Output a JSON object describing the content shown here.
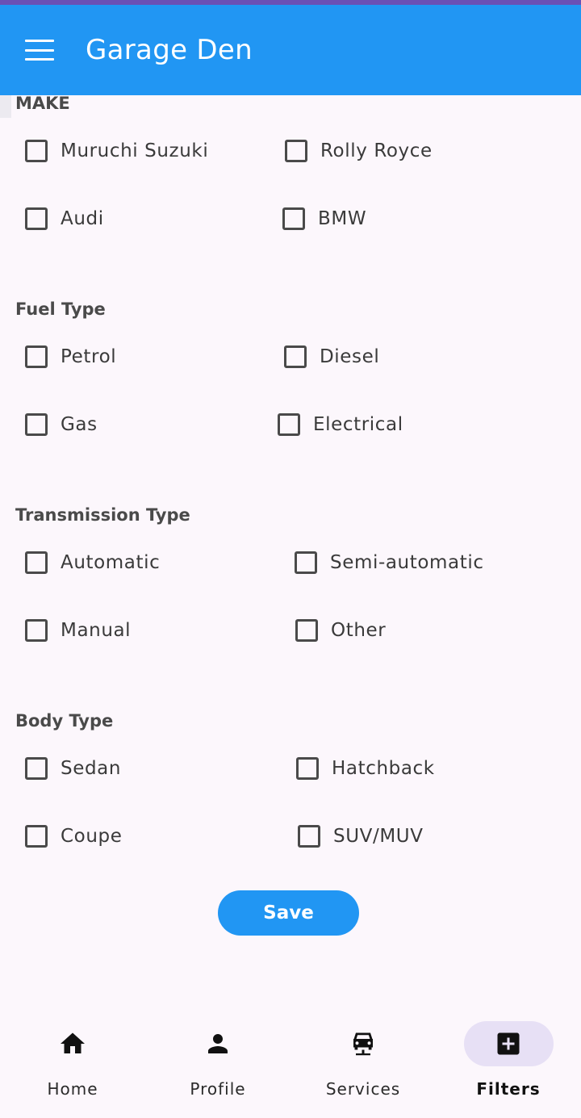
{
  "app_bar": {
    "title": "Garage Den",
    "background": "#2196f3"
  },
  "sections": {
    "make": {
      "title": "MAKE",
      "options": [
        "Muruchi Suzuki",
        "Rolly Royce",
        "Audi",
        "BMW"
      ]
    },
    "fuel": {
      "title": "Fuel Type",
      "options": [
        "Petrol",
        "Diesel",
        "Gas",
        "Electrical"
      ]
    },
    "transmission": {
      "title": "Transmission Type",
      "options": [
        "Automatic",
        "Semi-automatic",
        "Manual",
        "Other"
      ]
    },
    "body": {
      "title": "Body Type",
      "options": [
        "Sedan",
        "Hatchback",
        "Coupe",
        "SUV/MUV"
      ]
    }
  },
  "checked_state": "all-unchecked",
  "save_label": "Save",
  "bottom_nav": {
    "items": [
      {
        "label": "Home",
        "icon": "home-icon"
      },
      {
        "label": "Profile",
        "icon": "person-icon"
      },
      {
        "label": "Services",
        "icon": "car-service-icon"
      },
      {
        "label": "Filters",
        "icon": "add-box-icon"
      }
    ],
    "selected": "Filters",
    "selected_indicator_color": "#e7e0f5"
  }
}
